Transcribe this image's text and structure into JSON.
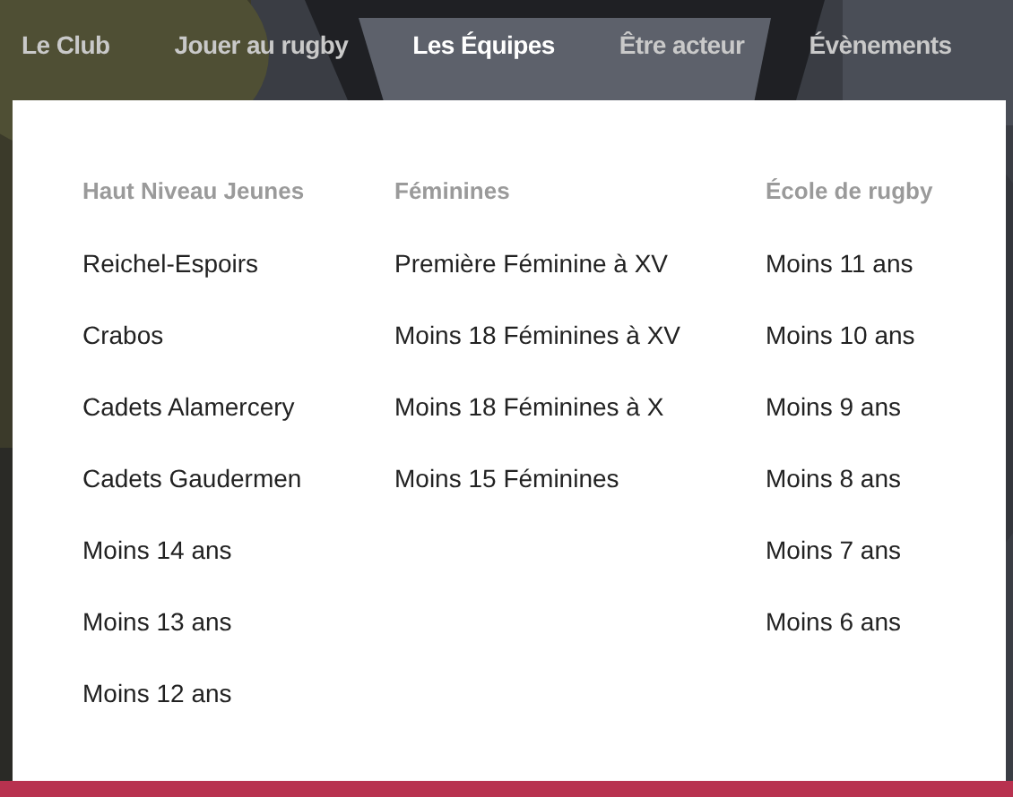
{
  "nav": [
    {
      "label": "Le Club",
      "selected": false
    },
    {
      "label": "Jouer au rugby",
      "selected": false
    },
    {
      "label": "Les Équipes",
      "selected": true
    },
    {
      "label": "Être acteur",
      "selected": false
    },
    {
      "label": "Évènements",
      "selected": false
    }
  ],
  "menu": {
    "columns": [
      {
        "heading": "Haut Niveau Jeunes",
        "items": [
          "Reichel-Espoirs",
          "Crabos",
          "Cadets Alamercery",
          "Cadets Gaudermen",
          "Moins 14 ans",
          "Moins 13 ans",
          "Moins 12 ans"
        ]
      },
      {
        "heading": "Féminines",
        "items": [
          "Première Féminine à XV",
          "Moins 18 Féminines à XV",
          "Moins 18 Féminines à X",
          "Moins 15 Féminines"
        ]
      },
      {
        "heading": "École de rugby",
        "items": [
          "Moins 11 ans",
          "Moins 10 ans",
          "Moins 9 ans",
          "Moins 8 ans",
          "Moins 7 ans",
          "Moins 6 ans"
        ]
      }
    ]
  }
}
